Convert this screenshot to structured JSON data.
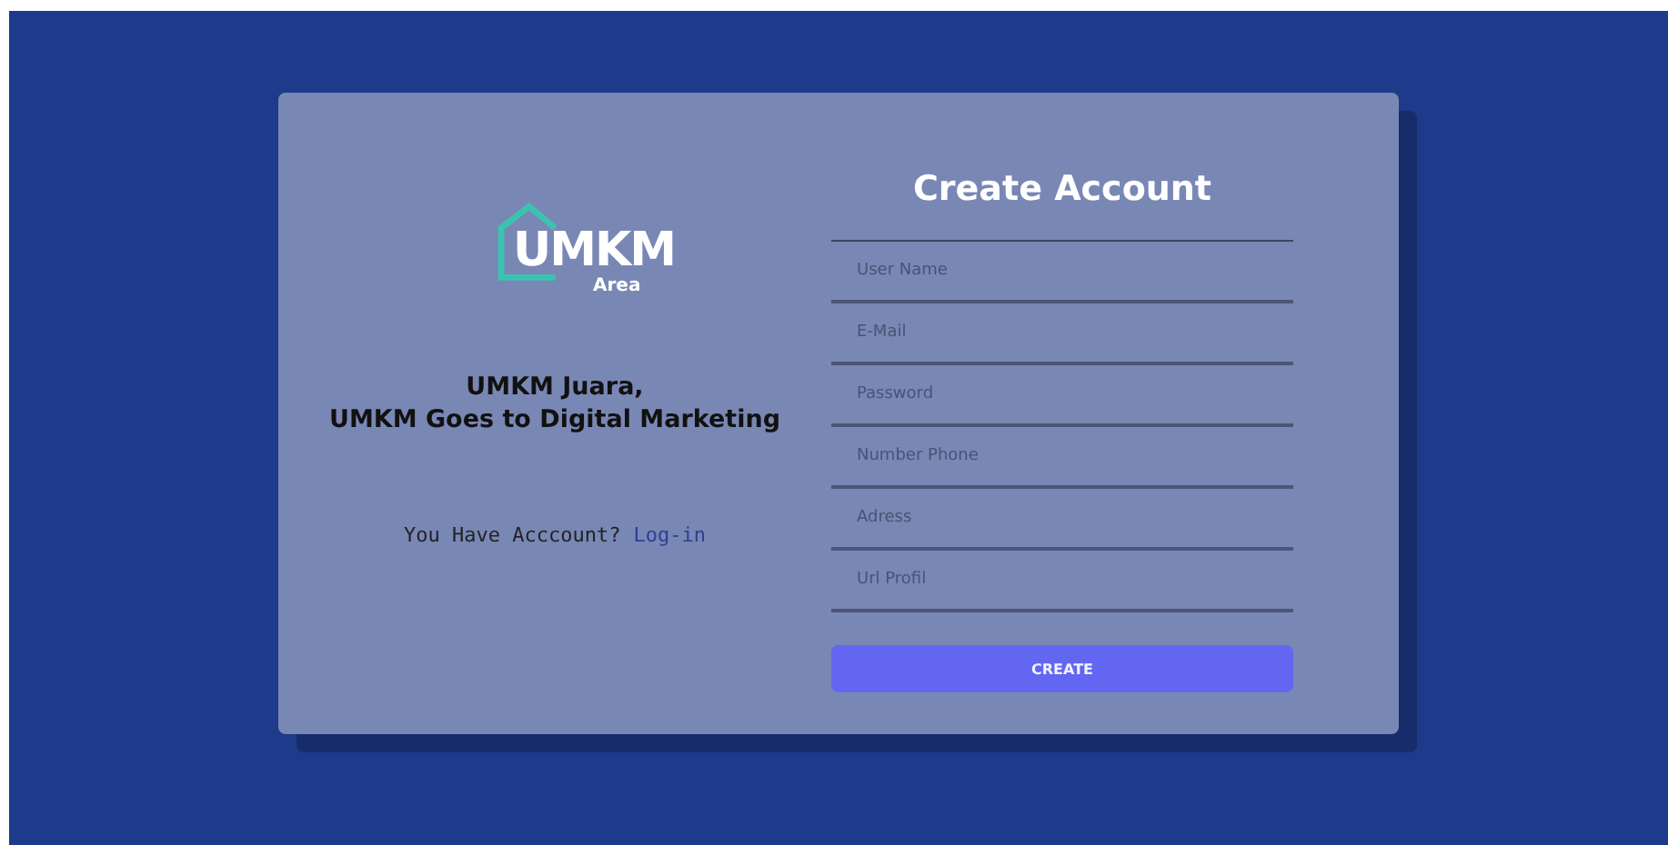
{
  "logo": {
    "word": "UMKM",
    "subword": "Area"
  },
  "tagline": [
    "UMKM Juara,",
    "UMKM Goes to Digital Marketing"
  ],
  "login_prompt": {
    "text": "You Have Acccount?",
    "link": "Log-in"
  },
  "form": {
    "title": "Create Account",
    "fields": [
      {
        "placeholder": "User Name"
      },
      {
        "placeholder": "E-Mail"
      },
      {
        "placeholder": "Password"
      },
      {
        "placeholder": "Number Phone"
      },
      {
        "placeholder": "Adress"
      },
      {
        "placeholder": "Url Profil"
      }
    ],
    "button": "CREATE"
  }
}
